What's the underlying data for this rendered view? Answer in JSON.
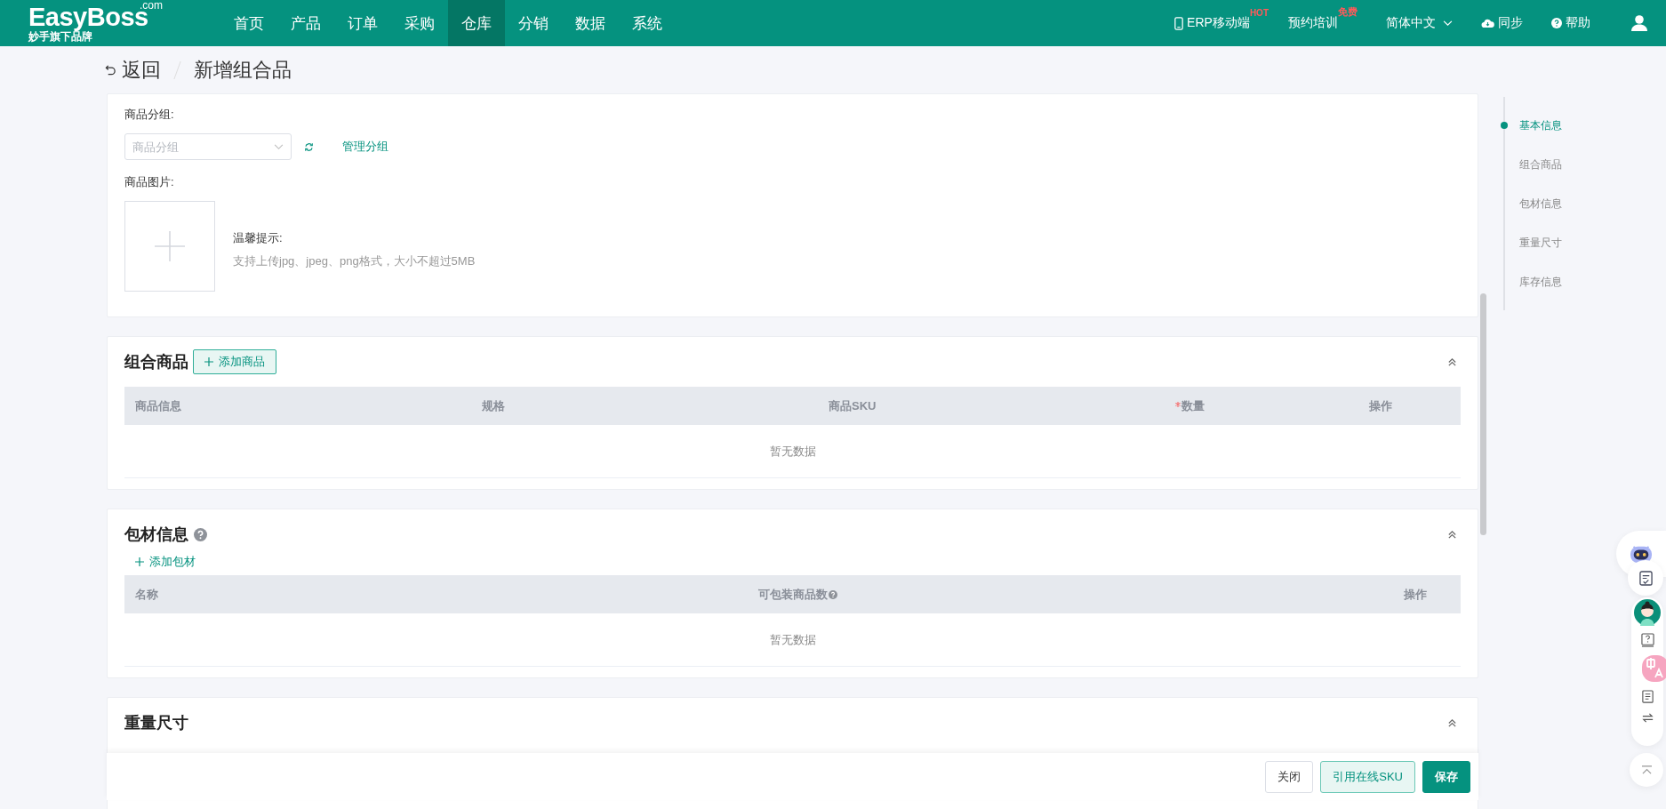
{
  "top_bar": {
    "logo": {
      "name": "EasyBoss",
      "suffix": ".com",
      "tagline": "妙手旗下品牌"
    },
    "nav": [
      {
        "label": "首页",
        "selected": false
      },
      {
        "label": "产品",
        "selected": false
      },
      {
        "label": "订单",
        "selected": false
      },
      {
        "label": "采购",
        "selected": false
      },
      {
        "label": "仓库",
        "selected": true
      },
      {
        "label": "分销",
        "selected": false
      },
      {
        "label": "数据",
        "selected": false
      },
      {
        "label": "系统",
        "selected": false
      }
    ],
    "actions": [
      {
        "kind": "mobile",
        "label": "ERP移动端",
        "badge": "HOT"
      },
      {
        "kind": "training",
        "label": "预约培训",
        "badge": "免费"
      },
      {
        "kind": "language",
        "label": "简体中文"
      },
      {
        "kind": "sync",
        "label": "同步"
      },
      {
        "kind": "help",
        "label": "帮助"
      },
      {
        "kind": "user"
      }
    ]
  },
  "breadcrumb": {
    "back": "返回",
    "title": "新增组合品"
  },
  "basic_info": {
    "group_label": "商品分组:",
    "group_select": {
      "placeholder": "商品分组"
    },
    "manage_link": "管理分组",
    "image_label": "商品图片:",
    "tip_title": "温馨提示:",
    "tip_text": "支持上传jpg、jpeg、png格式，大小不超过5MB"
  },
  "sections": [
    {
      "kind": "combo",
      "title": "组合商品",
      "action": "添加商品",
      "columns": [
        {
          "label": "商品信息"
        },
        {
          "label": "规格"
        },
        {
          "label": "商品SKU"
        },
        {
          "label": "数量",
          "required": true
        },
        {
          "label": "操作"
        }
      ],
      "empty": "暂无数据"
    },
    {
      "kind": "packaging",
      "title": "包材信息",
      "help": true,
      "action": "添加包材",
      "columns": [
        {
          "label": "名称"
        },
        {
          "label": "可包装商品数",
          "help": true
        },
        {
          "label": "操作"
        }
      ],
      "empty": "暂无数据"
    },
    {
      "kind": "weight",
      "title": "重量尺寸"
    }
  ],
  "anchor_nav": [
    {
      "label": "基本信息",
      "selected": true
    },
    {
      "label": "组合商品",
      "selected": false
    },
    {
      "label": "包材信息",
      "selected": false
    },
    {
      "label": "重量尺寸",
      "selected": false
    },
    {
      "label": "库存信息",
      "selected": false
    }
  ],
  "footer": {
    "buttons": [
      {
        "kind": "default",
        "label": "关闭"
      },
      {
        "kind": "secondary",
        "label": "引用在线SKU"
      },
      {
        "kind": "primary",
        "label": "保存"
      }
    ]
  }
}
